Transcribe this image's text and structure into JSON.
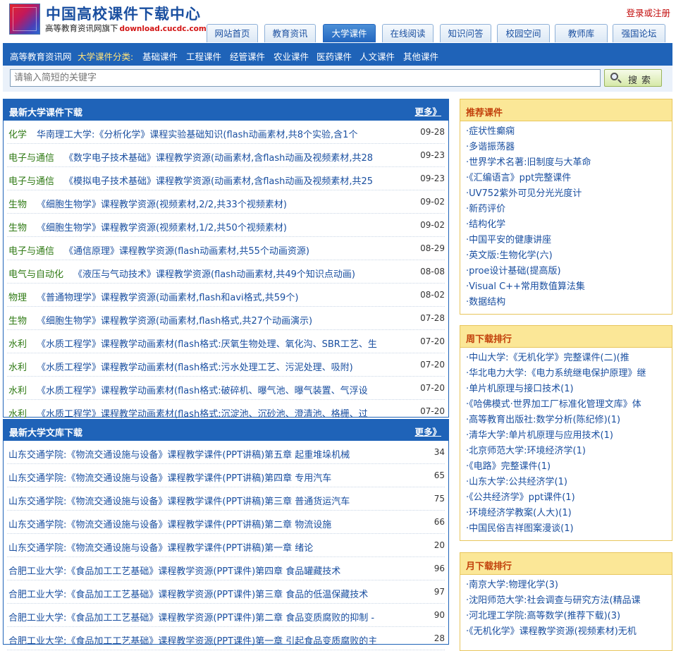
{
  "header": {
    "title": "中国高校课件下载中心",
    "subtitle": "高等教育资讯网旗下",
    "domain": "download.cucdc.com",
    "login": "登录或注册"
  },
  "tabs": [
    {
      "label": "网站首页",
      "active": false
    },
    {
      "label": "教育资讯",
      "active": false
    },
    {
      "label": "大学课件",
      "active": true
    },
    {
      "label": "在线阅读",
      "active": false
    },
    {
      "label": "知识问答",
      "active": false
    },
    {
      "label": "校园空间",
      "active": false
    },
    {
      "label": "教师库",
      "active": false
    },
    {
      "label": "强国论坛",
      "active": false
    }
  ],
  "nav": {
    "home": "高等教育资讯网",
    "category_label": "大学课件分类:",
    "items": [
      "基础课件",
      "工程课件",
      "经管课件",
      "农业课件",
      "医药课件",
      "人文课件",
      "其他课件"
    ]
  },
  "search": {
    "placeholder": "请输入简短的关键字",
    "button": "搜索"
  },
  "latest": {
    "title": "最新大学课件下载",
    "more": "更多》",
    "rows": [
      {
        "cat": "化学",
        "text": "华南理工大学:《分析化学》课程实验基础知识(flash动画素材,共8个实验,含1个",
        "date": "09-28"
      },
      {
        "cat": "电子与通信",
        "text": "《数字电子技术基础》课程教学资源(动画素材,含flash动画及视频素材,共28",
        "date": "09-23"
      },
      {
        "cat": "电子与通信",
        "text": "《模拟电子技术基础》课程教学资源(动画素材,含flash动画及视频素材,共25",
        "date": "09-23"
      },
      {
        "cat": "生物",
        "text": "《细胞生物学》课程教学资源(视频素材,2/2,共33个视频素材)",
        "date": "09-02"
      },
      {
        "cat": "生物",
        "text": "《细胞生物学》课程教学资源(视频素材,1/2,共50个视频素材)",
        "date": "09-02"
      },
      {
        "cat": "电子与通信",
        "text": "《通信原理》课程教学资源(flash动画素材,共55个动画资源)",
        "date": "08-29"
      },
      {
        "cat": "电气与自动化",
        "text": "《液压与气动技术》课程教学资源(flash动画素材,共49个知识点动画)",
        "date": "08-08"
      },
      {
        "cat": "物理",
        "text": "《普通物理学》课程教学资源(动画素材,flash和avi格式,共59个)",
        "date": "08-02"
      },
      {
        "cat": "生物",
        "text": "《细胞生物学》课程教学资源(动画素材,flash格式,共27个动画演示)",
        "date": "07-28"
      },
      {
        "cat": "水利",
        "text": "《水质工程学》课程教学动画素材(flash格式:厌氧生物处理、氧化沟、SBR工艺、生",
        "date": "07-20"
      },
      {
        "cat": "水利",
        "text": "《水质工程学》课程教学动画素材(flash格式:污水处理工艺、污泥处理、吸附)",
        "date": "07-20"
      },
      {
        "cat": "水利",
        "text": "《水质工程学》课程教学动画素材(flash格式:破碎机、曝气池、曝气装置、气浮设",
        "date": "07-20"
      },
      {
        "cat": "水利",
        "text": "《水质工程学》课程教学动画素材(flash格式:沉淀池、沉砂池、澄清池、格栅、过",
        "date": "07-20"
      }
    ]
  },
  "library": {
    "title": "最新大学文库下载",
    "more": "更多》",
    "rows": [
      {
        "text": "山东交通学院:《物流交通设施与设备》课程教学课件(PPT讲稿)第五章 起重堆垛机械",
        "num": "34"
      },
      {
        "text": "山东交通学院:《物流交通设施与设备》课程教学课件(PPT讲稿)第四章 专用汽车",
        "num": "65"
      },
      {
        "text": "山东交通学院:《物流交通设施与设备》课程教学课件(PPT讲稿)第三章 普通货运汽车",
        "num": "75"
      },
      {
        "text": "山东交通学院:《物流交通设施与设备》课程教学课件(PPT讲稿)第二章 物流设施",
        "num": "66"
      },
      {
        "text": "山东交通学院:《物流交通设施与设备》课程教学课件(PPT讲稿)第一章 绪论",
        "num": "20"
      },
      {
        "text": "合肥工业大学:《食品加工工艺基础》课程教学资源(PPT课件)第四章 食品罐藏技术",
        "num": "96"
      },
      {
        "text": "合肥工业大学:《食品加工工艺基础》课程教学资源(PPT课件)第三章 食品的低温保藏技术",
        "num": "97"
      },
      {
        "text": "合肥工业大学:《食品加工工艺基础》课程教学资源(PPT课件)第二章 食品变质腐败的抑制 -",
        "num": "90"
      },
      {
        "text": "合肥工业大学:《食品加工工艺基础》课程教学资源(PPT课件)第一章 引起食品变质腐败的主",
        "num": "28"
      }
    ]
  },
  "recommend": {
    "title": "推荐课件",
    "items": [
      "·症状性癫痫",
      "·多谐振荡器",
      "·世界学术名著:旧制度与大革命",
      "·《汇编语言》ppt完整课件",
      "·UV752紫外可见分光光度计",
      "·新药评价",
      "·结构化学",
      "·中国平安的健康讲座",
      "·英文版:生物化学(六)",
      "·proe设计基础(提高版)",
      "·Visual C++常用数值算法集",
      "·数据结构"
    ]
  },
  "weekly": {
    "title": "周下载排行",
    "items": [
      "·中山大学:《无机化学》完整课件(二)(推",
      "·华北电力大学:《电力系统继电保护原理》继",
      "·单片机原理与接口技术(1)",
      "·《哈佛模式·世界加工厂标准化管理文库》体",
      "·高等教育出版社:数学分析(陈纪修)(1)",
      "·清华大学:单片机原理与应用技术(1)",
      "·北京师范大学:环境经济学(1)",
      "·《电路》完整课件(1)",
      "·山东大学:公共经济学(1)",
      "·《公共经济学》ppt课件(1)",
      "·环境经济学教案(人大)(1)",
      "·中国民俗吉祥图案漫谈(1)"
    ]
  },
  "monthly": {
    "title": "月下载排行",
    "items": [
      "·南京大学:物理化学(3)",
      "·沈阳师范大学:社会调查与研究方法(精品课",
      "·河北理工学院:高等数学(推荐下载)(3)",
      "·《无机化学》课程教学资源(视频素材)无机"
    ]
  }
}
